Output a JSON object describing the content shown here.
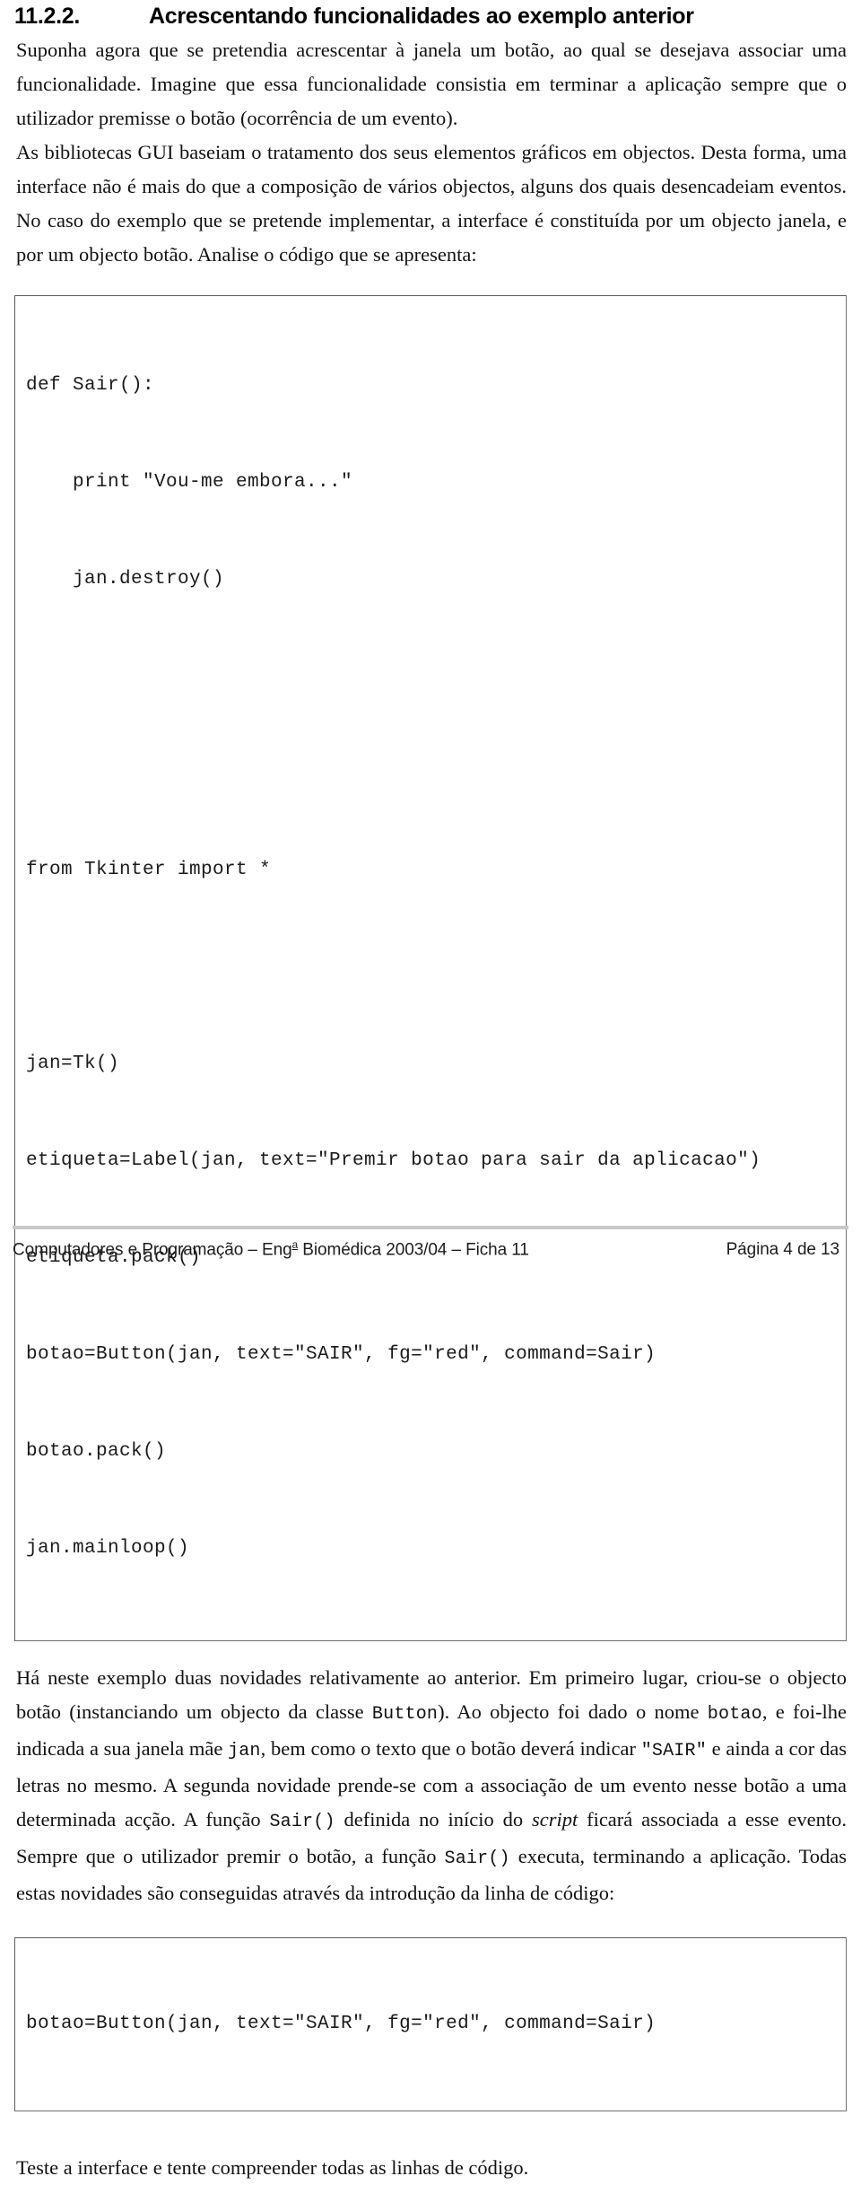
{
  "heading": {
    "number": "11.2.2.",
    "title": "Acrescentando funcionalidades ao exemplo anterior"
  },
  "paragraphs": {
    "intro_1": "Suponha agora que se pretendia acrescentar à janela um botão, ao qual se desejava associar  uma funcionalidade. Imagine que essa funcionalidade consistia em terminar a aplicação sempre que o utilizador premisse o botão (ocorrência de um evento).",
    "intro_2": "As bibliotecas GUI baseiam o tratamento dos seus elementos gráficos em objectos. Desta forma, uma interface não é mais do que a composição de vários objectos, alguns dos quais desencadeiam eventos. No caso do exemplo que se pretende implementar, a interface é constituída por um objecto janela, e por um objecto botão. Analise o código que se apresenta:",
    "after_code_p1_a": "Há neste exemplo duas novidades relativamente ao anterior. Em primeiro lugar, criou-se o objecto botão (instanciando um objecto da classe ",
    "after_code_p1_code1": "Button",
    "after_code_p1_b": "). Ao objecto foi dado o nome ",
    "after_code_p1_code2": "botao",
    "after_code_p1_c": ", e foi-lhe indicada a sua janela mãe ",
    "after_code_p1_code3": "jan",
    "after_code_p1_d": ", bem como o texto que o botão deverá indicar ",
    "after_code_p1_code4": "\"SAIR\"",
    "after_code_p1_e": "  e ainda a cor das letras no mesmo. A segunda novidade prende-se com a associação de um evento nesse botão a uma determinada acção. A função ",
    "after_code_p1_code5": "Sair()",
    "after_code_p1_f": " definida no início do ",
    "after_code_p1_italic": "script",
    "after_code_p1_g": " ficará associada a esse evento. Sempre que o utilizador premir o botão, a função ",
    "after_code_p1_code6": "Sair()",
    "after_code_p1_h": " executa, terminando a aplicação. Todas estas novidades são conseguidas através da introdução da linha de código:",
    "closing": "Teste a interface e tente compreender todas as linhas de código."
  },
  "code_block_main": {
    "lines": [
      "def Sair():",
      "    print \"Vou-me embora...\"",
      "    jan.destroy()",
      "",
      "",
      "from Tkinter import *",
      "",
      "jan=Tk()",
      "etiqueta=Label(jan, text=\"Premir botao para sair da aplicacao\")",
      "etiqueta.pack()",
      "botao=Button(jan, text=\"SAIR\", fg=\"red\", command=Sair)",
      "botao.pack()",
      "jan.mainloop()"
    ]
  },
  "code_block_single": {
    "line": "botao=Button(jan, text=\"SAIR\", fg=\"red\", command=Sair)"
  },
  "footer": {
    "left_before_sup": "Computadores e Programação – Eng",
    "left_sup": "a",
    "left_after_sup": " Biomédica 2003/04 – Ficha 11",
    "right": "Página 4 de 13"
  },
  "colors": {
    "text": "#000000",
    "code_border": "#5a5a5a",
    "footer_rule": "#c9c9c9"
  }
}
